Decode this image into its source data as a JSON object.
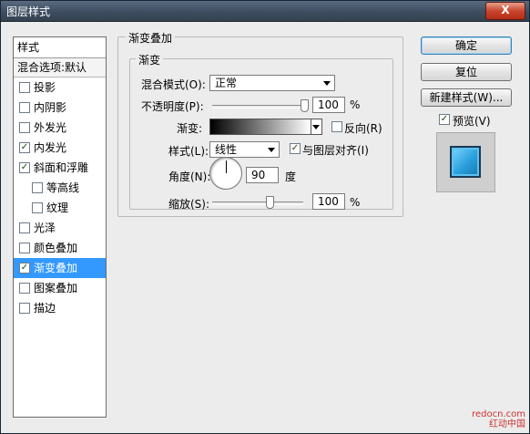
{
  "window": {
    "title": "图层样式",
    "close_label": "X"
  },
  "sidebar": {
    "header": "样式",
    "blend_options": "混合选项:默认",
    "items": [
      {
        "label": "投影",
        "checked": false,
        "sub": false
      },
      {
        "label": "内阴影",
        "checked": false,
        "sub": false
      },
      {
        "label": "外发光",
        "checked": false,
        "sub": false
      },
      {
        "label": "内发光",
        "checked": true,
        "sub": false
      },
      {
        "label": "斜面和浮雕",
        "checked": true,
        "sub": false
      },
      {
        "label": "等高线",
        "checked": false,
        "sub": true
      },
      {
        "label": "纹理",
        "checked": false,
        "sub": true
      },
      {
        "label": "光泽",
        "checked": false,
        "sub": false
      },
      {
        "label": "颜色叠加",
        "checked": false,
        "sub": false
      },
      {
        "label": "渐变叠加",
        "checked": true,
        "sub": false,
        "selected": true
      },
      {
        "label": "图案叠加",
        "checked": false,
        "sub": false
      },
      {
        "label": "描边",
        "checked": false,
        "sub": false
      }
    ]
  },
  "panel": {
    "title": "渐变叠加",
    "group_title": "渐变",
    "blend_mode_label": "混合模式(O):",
    "blend_mode_value": "正常",
    "opacity_label": "不透明度(P):",
    "opacity_value": "100",
    "opacity_unit": "%",
    "opacity_level": 1.0,
    "gradient_label": "渐变:",
    "reverse_label": "反向(R)",
    "reverse_checked": false,
    "style_label": "样式(L):",
    "style_value": "线性",
    "align_label": "与图层对齐(I)",
    "align_checked": true,
    "angle_label": "角度(N):",
    "angle_value": "90",
    "angle_unit": "度",
    "scale_label": "缩放(S):",
    "scale_value": "100",
    "scale_unit": "%",
    "scale_level": 0.5
  },
  "buttons": {
    "ok": "确定",
    "reset": "复位",
    "new_style": "新建样式(W)...",
    "preview_label": "预览(V)",
    "preview_checked": true
  },
  "watermark": {
    "line1": "redocn.com",
    "line2": "红动中国"
  },
  "colors": {
    "selected_bg": "#3399ff",
    "swatch": "#2aa0dc"
  }
}
